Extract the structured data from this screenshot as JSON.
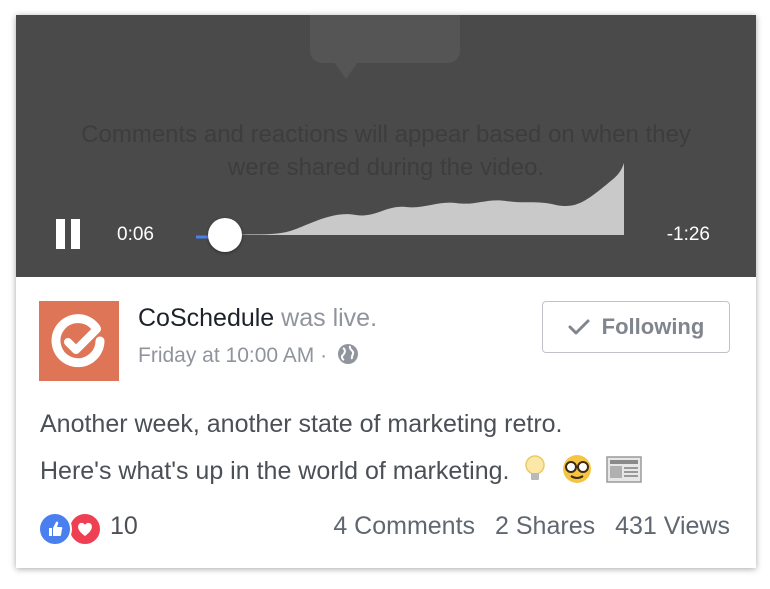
{
  "video": {
    "overlay_text": "Comments and reactions will appear based on when they were shared during the video.",
    "elapsed": "0:06",
    "remaining": "-1:26",
    "progress_fraction": 0.07
  },
  "post": {
    "page_name": "CoSchedule",
    "status": " was live.",
    "timestamp": "Friday at 10:00 AM",
    "separator": " · ",
    "follow_label": "Following",
    "text_line1": "Another week, another state of marketing retro.",
    "text_line2": "Here's what's up in the world of marketing.",
    "emojis": [
      "lightbulb-icon",
      "nerd-face-icon",
      "newspaper-icon"
    ]
  },
  "footer": {
    "reaction_count": "10",
    "comments": "4 Comments",
    "shares": "2 Shares",
    "views": "431 Views"
  },
  "colors": {
    "brand": "#de7556",
    "like": "#4a7ff0",
    "love": "#ef3f53",
    "progress": "#4a7ff0"
  }
}
